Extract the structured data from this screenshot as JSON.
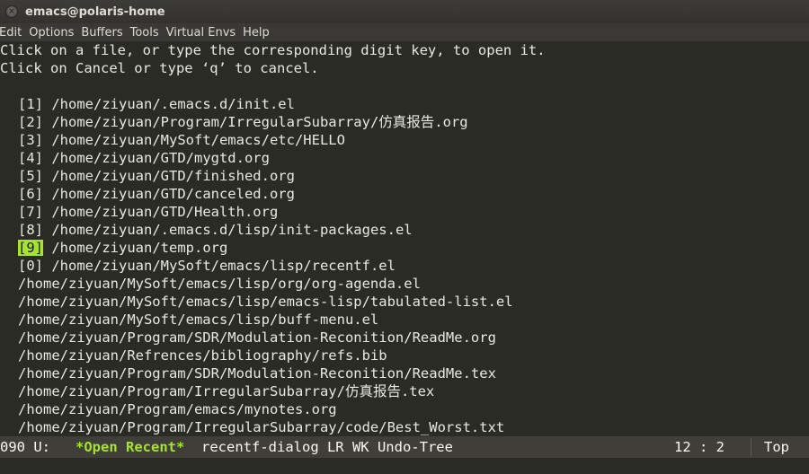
{
  "window": {
    "title": "emacs@polaris-home"
  },
  "menu": [
    "Edit",
    "Options",
    "Buffers",
    "Tools",
    "Virtual Envs",
    "Help"
  ],
  "header": [
    "Click on a file, or type the corresponding digit key, to open it.",
    "Click on Cancel or type ‘q’ to cancel."
  ],
  "numbered_files": [
    {
      "key": "[1]",
      "path": "/home/ziyuan/.emacs.d/init.el"
    },
    {
      "key": "[2]",
      "path": "/home/ziyuan/Program/IrregularSubarray/仿真报告.org"
    },
    {
      "key": "[3]",
      "path": "/home/ziyuan/MySoft/emacs/etc/HELLO"
    },
    {
      "key": "[4]",
      "path": "/home/ziyuan/GTD/mygtd.org"
    },
    {
      "key": "[5]",
      "path": "/home/ziyuan/GTD/finished.org"
    },
    {
      "key": "[6]",
      "path": "/home/ziyuan/GTD/canceled.org"
    },
    {
      "key": "[7]",
      "path": "/home/ziyuan/GTD/Health.org"
    },
    {
      "key": "[8]",
      "path": "/home/ziyuan/.emacs.d/lisp/init-packages.el"
    },
    {
      "key": "[9]",
      "path": "/home/ziyuan/temp.org"
    },
    {
      "key": "[0]",
      "path": "/home/ziyuan/MySoft/emacs/lisp/recentf.el"
    }
  ],
  "other_files": [
    "/home/ziyuan/MySoft/emacs/lisp/org/org-agenda.el",
    "/home/ziyuan/MySoft/emacs/lisp/emacs-lisp/tabulated-list.el",
    "/home/ziyuan/MySoft/emacs/lisp/buff-menu.el",
    "/home/ziyuan/Program/SDR/Modulation-Reconition/ReadMe.org",
    "/home/ziyuan/Refrences/bibliography/refs.bib",
    "/home/ziyuan/Program/SDR/Modulation-Reconition/ReadMe.tex",
    "/home/ziyuan/Program/IrregularSubarray/仿真报告.tex",
    "/home/ziyuan/Program/emacs/mynotes.org",
    "/home/ziyuan/Program/IrregularSubarray/code/Best_Worst.txt"
  ],
  "modeline": {
    "left": "090 U:",
    "buffer_name": "*Open Recent*",
    "modes": "recentf-dialog LR WK Undo-Tree",
    "line": "12",
    "column": "2",
    "position": "Top"
  },
  "colors": {
    "accent": "#a6e22e",
    "background": "#2b2b26",
    "modeline": "#403e39"
  }
}
